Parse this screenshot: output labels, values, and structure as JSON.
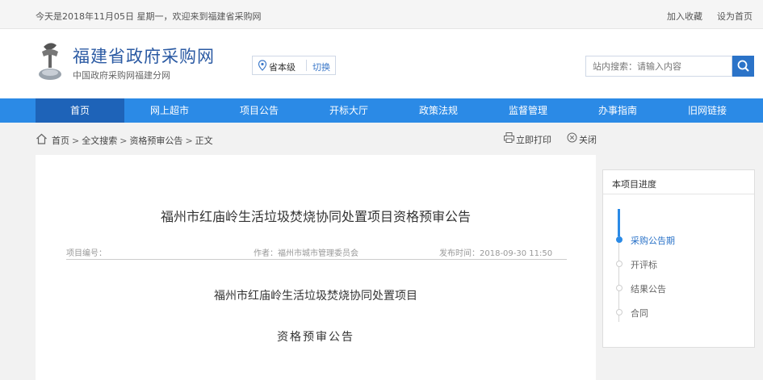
{
  "topbar": {
    "greeting": "今天是2018年11月05日 星期一，欢迎来到福建省采购网",
    "favorite": "加入收藏",
    "set_home": "设为首页"
  },
  "header": {
    "title": "福建省政府采购网",
    "subtitle": "中国政府采购网福建分网",
    "region_level": "省本级",
    "region_switch": "切换",
    "search_placeholder": "站内搜索：请输入内容"
  },
  "nav": {
    "items": [
      {
        "label": "首页"
      },
      {
        "label": "网上超市"
      },
      {
        "label": "项目公告"
      },
      {
        "label": "开标大厅"
      },
      {
        "label": "政策法规"
      },
      {
        "label": "监督管理"
      },
      {
        "label": "办事指南"
      },
      {
        "label": "旧网链接"
      }
    ]
  },
  "breadcrumb": {
    "home": "首页",
    "search": "全文搜索",
    "category": "资格预审公告",
    "current": "正文",
    "separator": ">"
  },
  "actions": {
    "print": "立即打印",
    "close": "关闭"
  },
  "article": {
    "title": "福州市红庙岭生活垃圾焚烧协同处置项目资格预审公告",
    "project_number": "项目编号：",
    "author": "作者：福州市城市管理委员会",
    "publish_time": "发布时间：2018-09-30 11:50",
    "subtitle_1": "福州市红庙岭生活垃圾焚烧协同处置项目",
    "subtitle_2": "资格预审公告"
  },
  "progress": {
    "title": "本项目进度",
    "steps": [
      {
        "label": "采购公告期"
      },
      {
        "label": "开评标"
      },
      {
        "label": "结果公告"
      },
      {
        "label": "合同"
      }
    ]
  },
  "colors": {
    "nav_bg": "#2b8ae6",
    "nav_active": "#1e63b8",
    "brand_text": "#2b5aa3",
    "link": "#3b78c9"
  }
}
